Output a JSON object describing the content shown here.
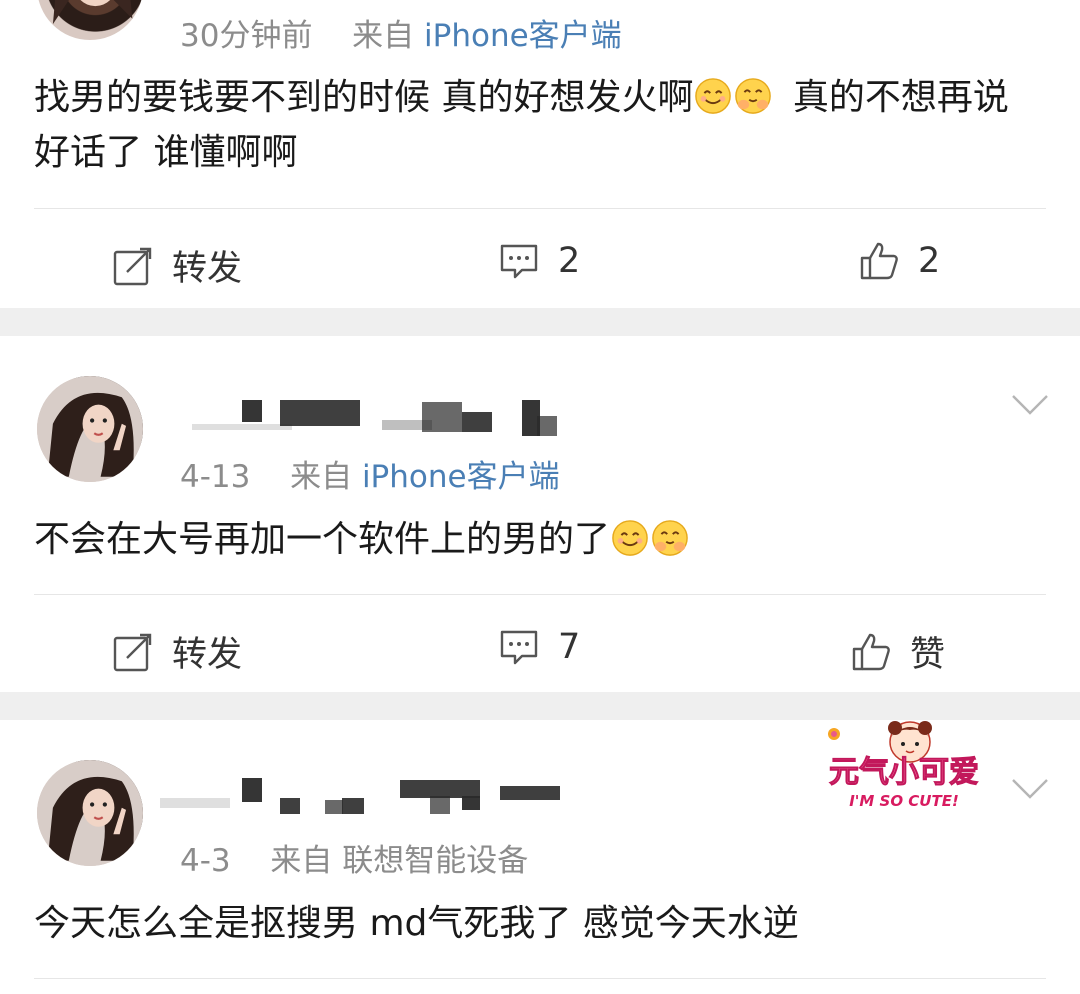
{
  "posts": [
    {
      "meta": {
        "time": "30分钟前",
        "from": "来自",
        "source": "iPhone客户端"
      },
      "content_parts": [
        "找男的要钱要不到的时候 真的好想发火啊",
        "真的不想再说好话了 谁懂啊啊"
      ],
      "actions": {
        "repost": "转发",
        "comments": "2",
        "likes": "2"
      }
    },
    {
      "meta": {
        "time": "4-13",
        "from": "来自",
        "source": "iPhone客户端"
      },
      "content_parts": [
        "不会在大号再加一个软件上的男的了"
      ],
      "actions": {
        "repost": "转发",
        "comments": "7",
        "likes": "赞"
      }
    },
    {
      "meta": {
        "time": "4-3",
        "from": "来自",
        "source": "联想智能设备"
      },
      "content_parts": [
        "今天怎么全是抠搜男 md气死我了 感觉今天水逆"
      ]
    }
  ],
  "sticker": {
    "title": "元气小可爱",
    "subtitle": "I'M SO CUTE!"
  },
  "icons": [
    "repost-icon",
    "comment-icon",
    "like-icon",
    "chevron-down-icon",
    "smile-emoji",
    "blush-emoji"
  ],
  "colors": {
    "link": "#4a7fb5",
    "meta": "#8c8c8c",
    "separator": "#efefef"
  }
}
